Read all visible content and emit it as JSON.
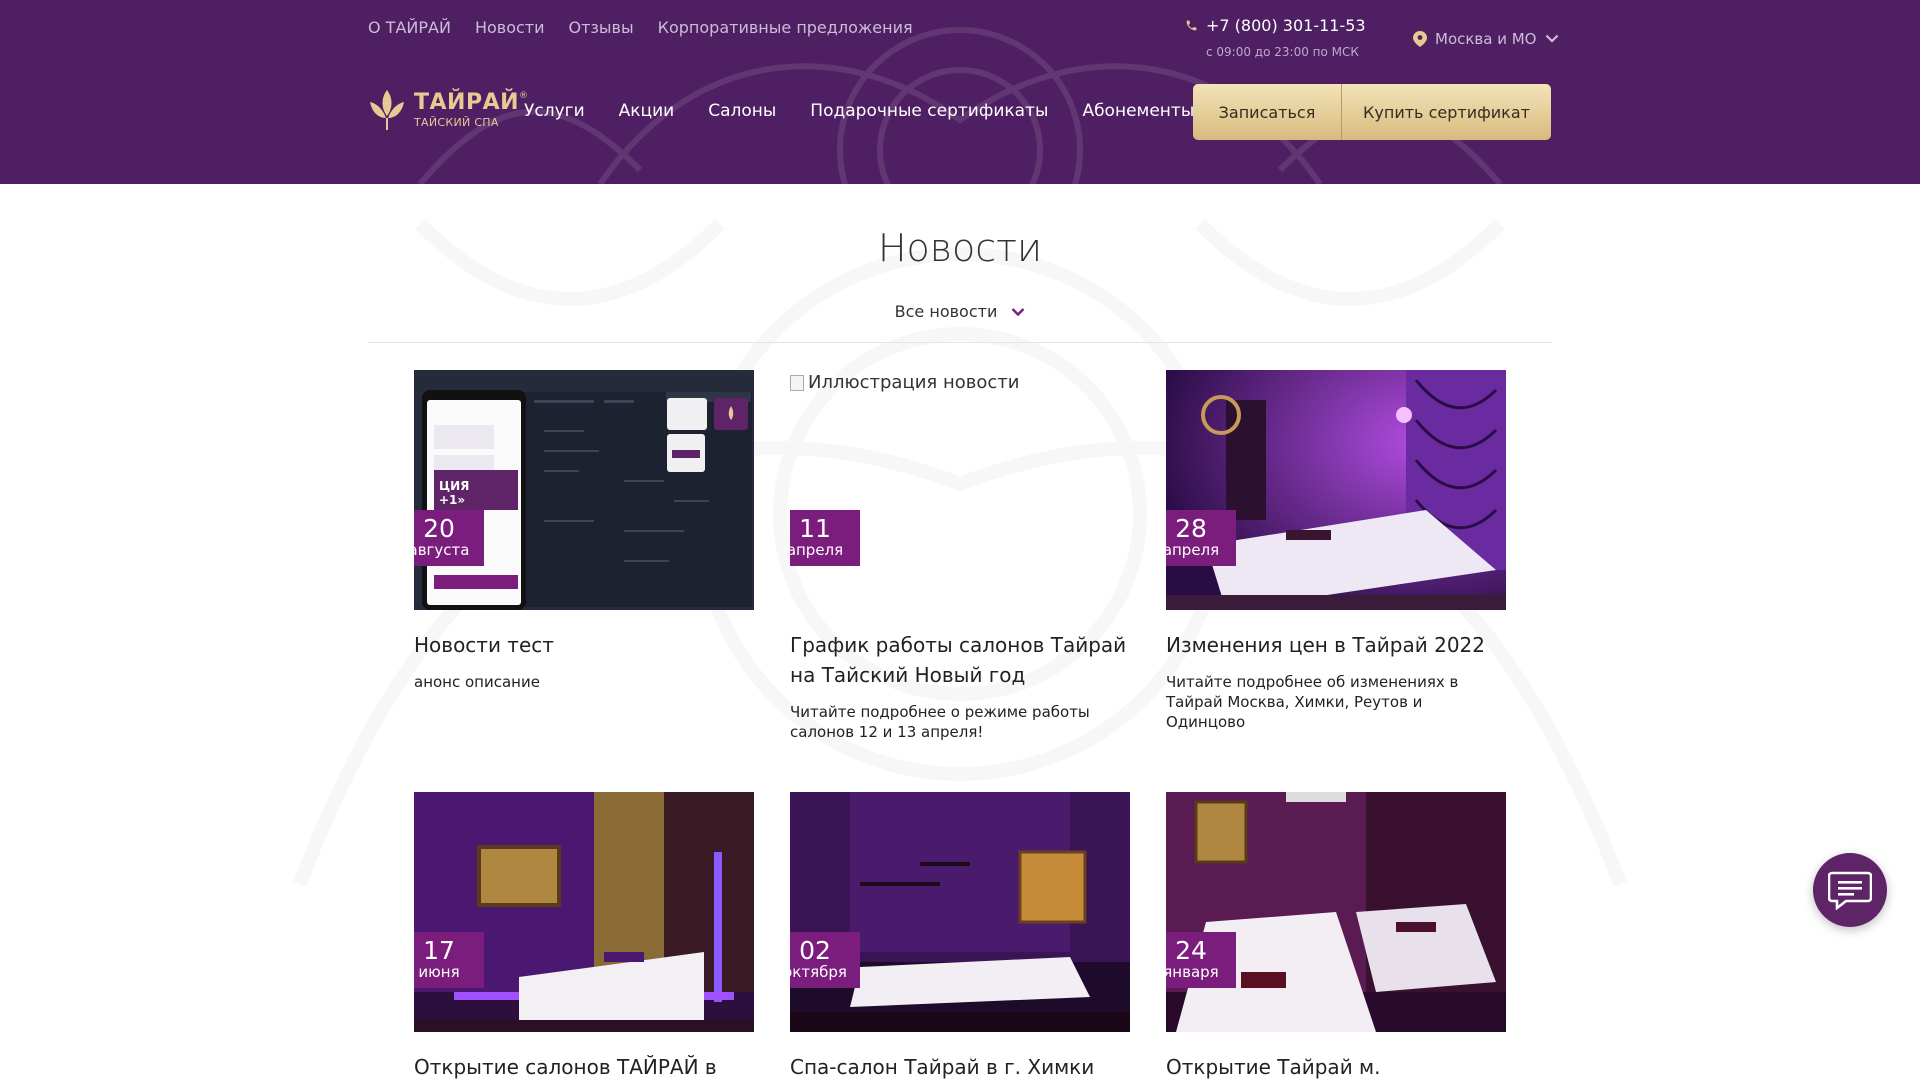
{
  "topnav": [
    "О ТАЙРАЙ",
    "Новости",
    "Отзывы",
    "Корпоративные предложения"
  ],
  "contact": {
    "phone": "+7 (800) 301-11-53",
    "hours": "с 09:00 до 23:00 по МСК"
  },
  "city": "Москва и МО",
  "logo": {
    "title": "ТАЙРАЙ",
    "reg": "®",
    "subtitle": "ТАЙСКИЙ СПА"
  },
  "mainnav": [
    "Услуги",
    "Акции",
    "Салоны",
    "Подарочные сертификаты",
    "Абонементы"
  ],
  "cta": {
    "book": "Записаться",
    "buy": "Купить сертификат"
  },
  "page": {
    "title": "Новости",
    "filter": "Все новости"
  },
  "news": [
    {
      "day": "20",
      "month": "августа",
      "title": "Новости тест",
      "desc": "анонс описание",
      "image": "screenshot"
    },
    {
      "day": "11",
      "month": "апреля",
      "title": "График работы салонов Тайрай на Тайский Новый год",
      "desc": "Читайте подробнее о режиме работы салонов 12 и 13 апреля!",
      "image": "broken",
      "alt": "Иллюстрация новости"
    },
    {
      "day": "28",
      "month": "апреля",
      "title": "Изменения цен в Тайрай 2022",
      "desc": "Читайте подробнее об изменениях в Тайрай Москва, Химки, Реутов и Одинцово",
      "image": "room"
    },
    {
      "day": "17",
      "month": "июня",
      "title": "Открытие салонов ТАЙРАЙ в",
      "desc": "",
      "image": "room"
    },
    {
      "day": "02",
      "month": "октября",
      "title": "Спа-салон Тайрай в г. Химки",
      "desc": "",
      "image": "room"
    },
    {
      "day": "24",
      "month": "января",
      "title": "Открытие Тайрай м. Молодежная",
      "desc": "",
      "image": "room"
    }
  ],
  "colors": {
    "header": "#4f1f63",
    "accent": "#7b1d7c",
    "gold": "#e5cb93"
  }
}
